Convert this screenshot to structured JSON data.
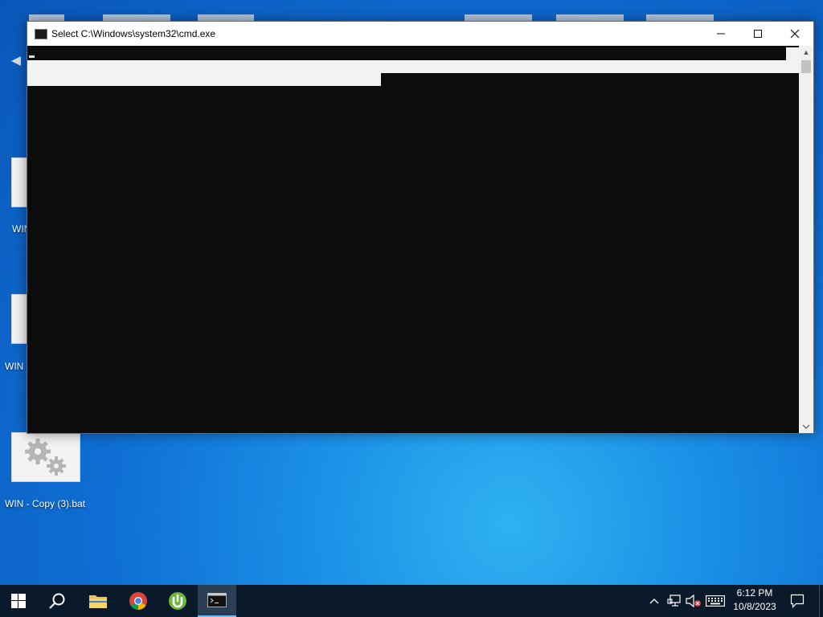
{
  "desktop": {
    "icons": [
      {
        "label": "WIN"
      },
      {
        "label": "WIN"
      },
      {
        "label": "WIN - Copy (3).bat"
      }
    ]
  },
  "cmd_window": {
    "title": "Select C:\\Windows\\system32\\cmd.exe",
    "icon": "cmd-icon",
    "state": "selection mode, console content selected (highlighted)"
  },
  "taskbar": {
    "pinned": [
      {
        "name": "start",
        "icon": "windows-logo-icon"
      },
      {
        "name": "search",
        "icon": "search-icon"
      },
      {
        "name": "file-explorer",
        "icon": "folder-icon"
      },
      {
        "name": "chrome",
        "icon": "chrome-icon"
      },
      {
        "name": "utorrent",
        "icon": "utorrent-icon"
      },
      {
        "name": "cmd",
        "icon": "cmd-icon",
        "active": true
      }
    ],
    "clock": {
      "time": "6:12 PM",
      "date": "10/8/2023"
    }
  },
  "colors": {
    "taskbar_bg": "#0b1a2b",
    "console_bg": "#0c0c0c",
    "selection": "#f2f2f2",
    "accent": "#0f6fd4"
  }
}
